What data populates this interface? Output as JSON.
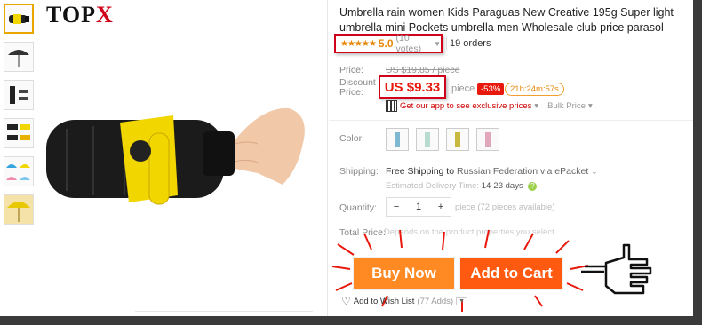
{
  "brand": {
    "main": "TOP",
    "accent": "X"
  },
  "product": {
    "title": "Umbrella rain women Kids Paraguas New Creative 195g Super light umbrella mini Pockets umbrella men Wholesale club price parasol",
    "stars": "★★★★★",
    "rating": "5.0",
    "votes": "(10 votes)",
    "orders": "19 orders"
  },
  "price": {
    "price_label": "Price:",
    "original": "US $19.85 / piece",
    "discount_label": "Discount Price:",
    "discount": "US $9.33",
    "unit": "piece",
    "off": "-53%",
    "timer": "21h:24m:57s",
    "app_link": "Get our app to see exclusive prices",
    "bulk": "Bulk Price"
  },
  "options": {
    "color_label": "Color:",
    "shipping_label": "Shipping:",
    "shipping_free": "Free Shipping to",
    "shipping_dest": "Russian Federation via ePacket",
    "est_label": "Estimated Delivery Time:",
    "est_value": "14-23 days",
    "quantity_label": "Quantity:",
    "quantity_value": "1",
    "minus": "−",
    "plus": "+",
    "quantity_note": "piece (72 pieces available)",
    "total_label": "Total Price:",
    "total_note": "Depends on the product properties you select"
  },
  "actions": {
    "buy_now": "Buy Now",
    "add_to_cart": "Add to Cart",
    "wishlist": "Add to Wish List",
    "wishlist_adds": "(77 Adds)"
  },
  "colors": {
    "accent": "#ff6a1a",
    "highlight": "#d0021b",
    "rating": "#e8890b"
  }
}
